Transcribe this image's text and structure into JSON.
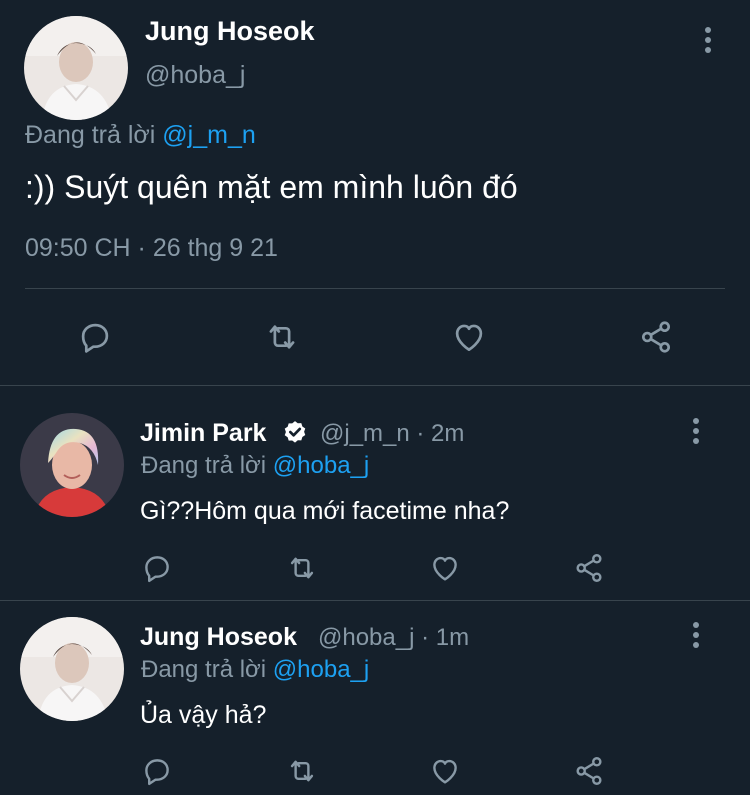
{
  "main_tweet": {
    "author_name": "Jung Hoseok",
    "author_handle": "@hoba_j",
    "replying_to_prefix": "Đang trả lời",
    "replying_to_handle": "@j_m_n",
    "text": ":)) Suýt quên mặt em mình luôn đó",
    "timestamp": "09:50 CH · 26 thg 9 21"
  },
  "replies": [
    {
      "author_name": "Jimin Park",
      "verified": true,
      "handle_time": "@j_m_n · 2m",
      "replying_to_prefix": "Đang trả lời",
      "replying_to_handle": "@hoba_j",
      "text": "Gì??Hôm qua mới facetime nha?"
    },
    {
      "author_name": "Jung Hoseok",
      "verified": false,
      "handle_time": "@hoba_j · 1m",
      "replying_to_prefix": "Đang trả lời",
      "replying_to_handle": "@hoba_j",
      "text": "Ủa vậy hả?"
    }
  ],
  "icons": {
    "reply": "reply-icon",
    "retweet": "retweet-icon",
    "like": "heart-icon",
    "share": "share-icon",
    "more": "more-options-icon",
    "verified": "verified-badge-icon"
  },
  "colors": {
    "background": "#15202b",
    "text": "#ffffff",
    "muted": "#8899a6",
    "link": "#1da1f2",
    "divider": "#38444d"
  }
}
